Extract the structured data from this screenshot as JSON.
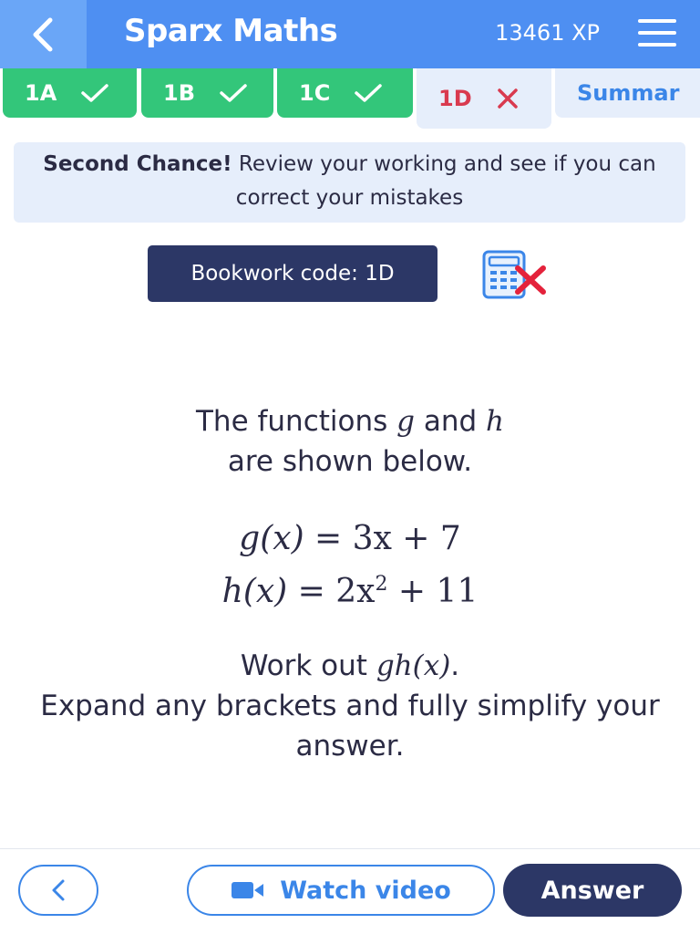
{
  "header": {
    "title": "Sparx Maths",
    "xp": "13461 XP"
  },
  "tabs": [
    {
      "label": "1A",
      "status": "correct"
    },
    {
      "label": "1B",
      "status": "correct"
    },
    {
      "label": "1C",
      "status": "correct"
    },
    {
      "label": "1D",
      "status": "incorrect"
    },
    {
      "label": "Summar",
      "status": "summary"
    }
  ],
  "notice": {
    "bold": "Second Chance!",
    "text": " Review your working and see if you can correct your mistakes"
  },
  "bookwork": {
    "label": "Bookwork code: 1D"
  },
  "question": {
    "intro_pre": "The functions ",
    "g": "g",
    "and": " and ",
    "h": "h",
    "intro_post": " are shown below.",
    "eq1_lhs": "g(x)",
    "eq1_rhs": " = 3x + 7",
    "eq2_lhs": "h(x)",
    "eq2_rhs_a": " = 2x",
    "eq2_exp": "2",
    "eq2_rhs_b": " + 11",
    "work_out": "Work out ",
    "target": "gh(x)",
    "period": ".",
    "instruction": "Expand any brackets and fully simplify your answer."
  },
  "footer": {
    "video_label": "Watch video",
    "answer_label": "Answer"
  },
  "colors": {
    "header": "#4e8ff2",
    "tab_done": "#33c67a",
    "tab_wrong_text": "#d93a4f",
    "accent_blue": "#3b86e8",
    "navy": "#2c3766"
  },
  "icons": {
    "back": "chevron-left-icon",
    "menu": "hamburger-menu-icon",
    "tick": "check-icon",
    "cross": "close-icon",
    "calculator": "calculator-not-allowed-icon",
    "video": "video-camera-icon"
  }
}
